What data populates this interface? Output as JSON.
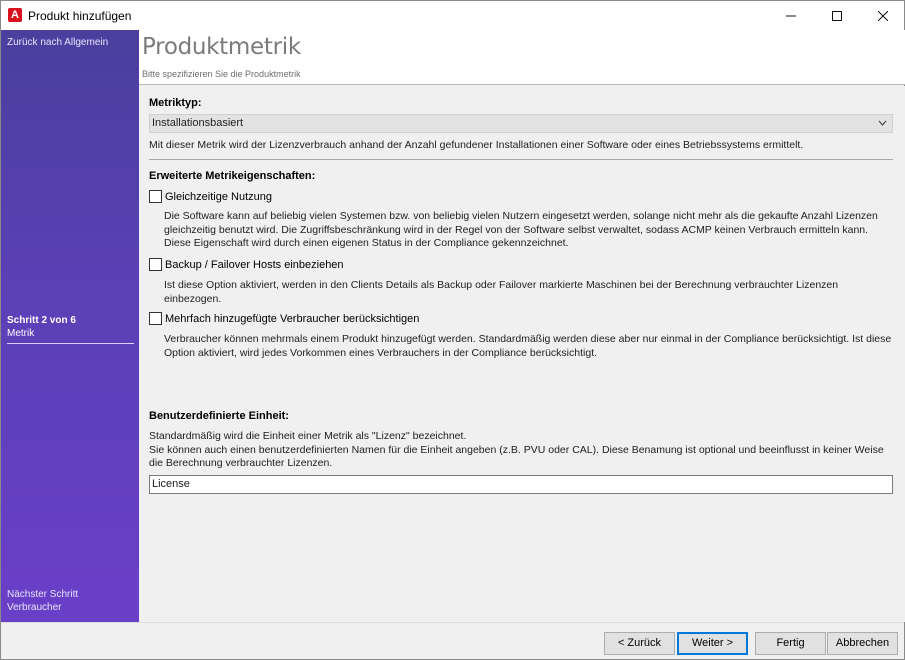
{
  "window": {
    "title": "Produkt hinzufügen",
    "icon_letter": "A",
    "icon": "app-logo-icon",
    "controls": [
      "minimize-icon",
      "maximize-icon",
      "close-icon"
    ]
  },
  "sidebar": {
    "back_label": "Zurück nach Allgemein",
    "step_label": "Schritt 2 von 6",
    "step_name": "Metrik",
    "next_label": "Nächster Schritt",
    "next_name": "Verbraucher"
  },
  "header": {
    "title": "Produktmetrik",
    "subtitle": "Bitte spezifizieren Sie die Produktmetrik"
  },
  "metric": {
    "label": "Metriktyp:",
    "selected": "Installationsbasiert",
    "description": "Mit dieser Metrik wird der Lizenzverbrauch anhand der Anzahl gefundener Installationen einer Software oder eines Betriebssystems ermittelt."
  },
  "extended": {
    "label": "Erweiterte Metrikeigenschaften:",
    "options": [
      {
        "label": "Gleichzeitige Nutzung",
        "checked": false,
        "description": "Die Software kann auf beliebig vielen Systemen bzw. von beliebig vielen Nutzern eingesetzt werden, solange nicht mehr als die gekaufte Anzahl Lizenzen gleichzeitig benutzt wird. Die Zugriffsbeschränkung wird in der Regel von der Software selbst verwaltet, sodass ACMP keinen Verbrauch ermitteln kann. Diese Eigenschaft wird durch einen eigenen Status in der Compliance gekennzeichnet."
      },
      {
        "label": "Backup / Failover Hosts einbeziehen",
        "checked": false,
        "description": "Ist diese Option aktiviert, werden in den Clients Details als Backup oder Failover markierte Maschinen bei der Berechnung verbrauchter Lizenzen einbezogen."
      },
      {
        "label": "Mehrfach hinzugefügte Verbraucher berücksichtigen",
        "checked": false,
        "description": "Verbraucher können mehrmals einem Produkt hinzugefügt werden. Standardmäßig werden diese aber nur einmal in der Compliance berücksichtigt. Ist diese Option aktiviert, wird jedes Vorkommen eines Verbrauchers in der Compliance berücksichtigt."
      }
    ]
  },
  "unit": {
    "label": "Benutzerdefinierte Einheit:",
    "description_line1": "Standardmäßig wird die Einheit einer Metrik als \"Lizenz\" bezeichnet.",
    "description_line2": "Sie können auch einen benutzerdefinierten Namen für die Einheit angeben (z.B. PVU oder CAL). Diese Benamung ist optional und beeinflusst in keiner Weise die Berechnung verbrauchter Lizenzen.",
    "value": "License"
  },
  "footer": {
    "back": "< Zurück",
    "next": "Weiter >",
    "finish": "Fertig",
    "cancel": "Abbrechen"
  }
}
